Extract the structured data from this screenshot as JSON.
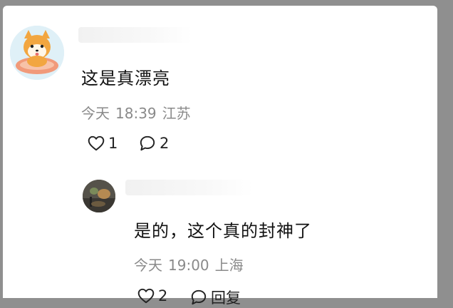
{
  "comments": [
    {
      "text": "这是真漂亮",
      "date": "今天",
      "time": "18:39",
      "location": "江苏",
      "likes": "1",
      "replies": "2"
    },
    {
      "text": "是的，这个真的封神了",
      "date": "今天",
      "time": "19:00",
      "location": "上海",
      "likes": "2",
      "reply_label": "回复"
    }
  ]
}
